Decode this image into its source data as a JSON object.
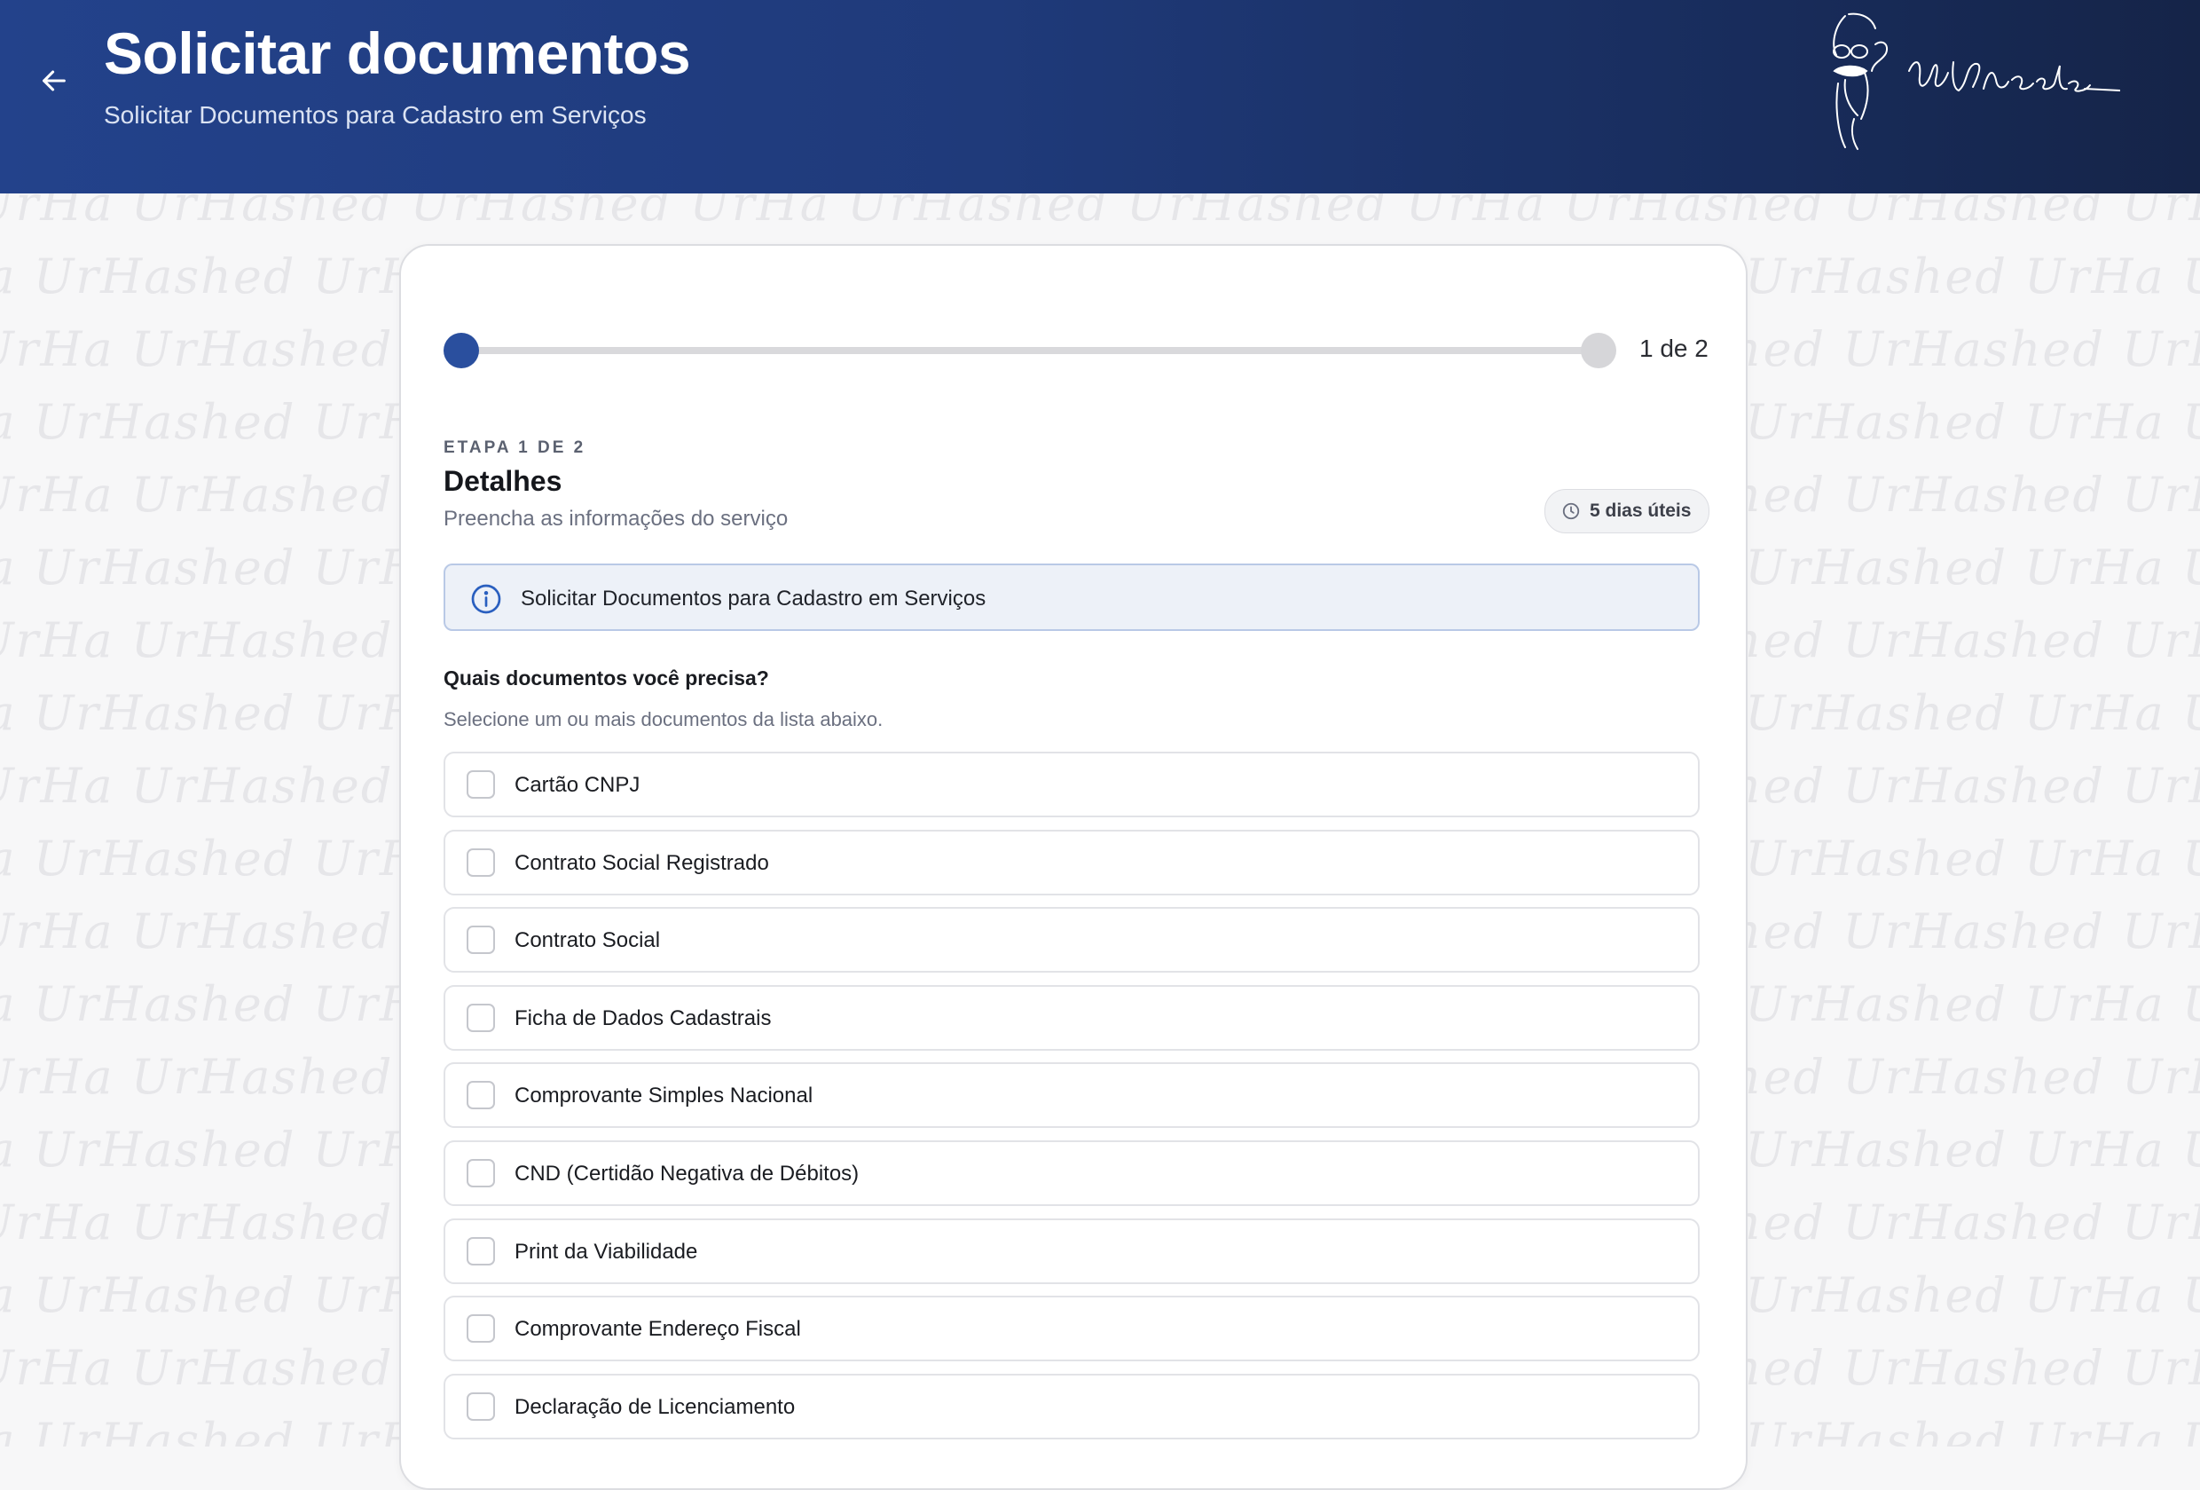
{
  "header": {
    "title": "Solicitar documentos",
    "subtitle": "Solicitar Documentos para Cadastro em Serviços",
    "back_icon": "arrow-left-icon",
    "logo": {
      "icon": "logo-mascot-signature",
      "text": "WrHashed"
    }
  },
  "background": {
    "pattern_text": "UrHa UrHashed UrHashed UrHa UrHashed UrHashed UrHa UrHashed UrHashed UrHa UrHashed UrHashed UrHa UrHashed UrHashed UrHa"
  },
  "progress": {
    "label": "1 de 2",
    "current_step": 1,
    "total_steps": 2,
    "fraction": 0.0,
    "active_color": "#2a4f9e",
    "inactive_color": "#d6d6d9"
  },
  "step": {
    "eyebrow": "ETAPA 1 DE 2",
    "title": "Detalhes",
    "description": "Preencha as informações do serviço",
    "time_badge": {
      "icon": "clock-icon",
      "label": "5 dias úteis"
    }
  },
  "info": {
    "icon": "info-icon",
    "text": "Solicitar Documentos para Cadastro em Serviços"
  },
  "question": {
    "label": "Quais documentos você precisa?",
    "hint": "Selecione um ou mais documentos da lista abaixo."
  },
  "documents": [
    {
      "label": "Cartão CNPJ",
      "checked": false
    },
    {
      "label": "Contrato Social Registrado",
      "checked": false
    },
    {
      "label": "Contrato Social",
      "checked": false
    },
    {
      "label": "Ficha de Dados Cadastrais",
      "checked": false
    },
    {
      "label": "Comprovante Simples Nacional",
      "checked": false
    },
    {
      "label": "CND (Certidão Negativa de Débitos)",
      "checked": false
    },
    {
      "label": "Print da Viabilidade",
      "checked": false
    },
    {
      "label": "Comprovante Endereço Fiscal",
      "checked": false
    },
    {
      "label": "Declaração de Licenciamento",
      "checked": false
    }
  ],
  "colors": {
    "header_start": "#23428b",
    "header_end": "#152448",
    "accent": "#2a4f9e"
  }
}
